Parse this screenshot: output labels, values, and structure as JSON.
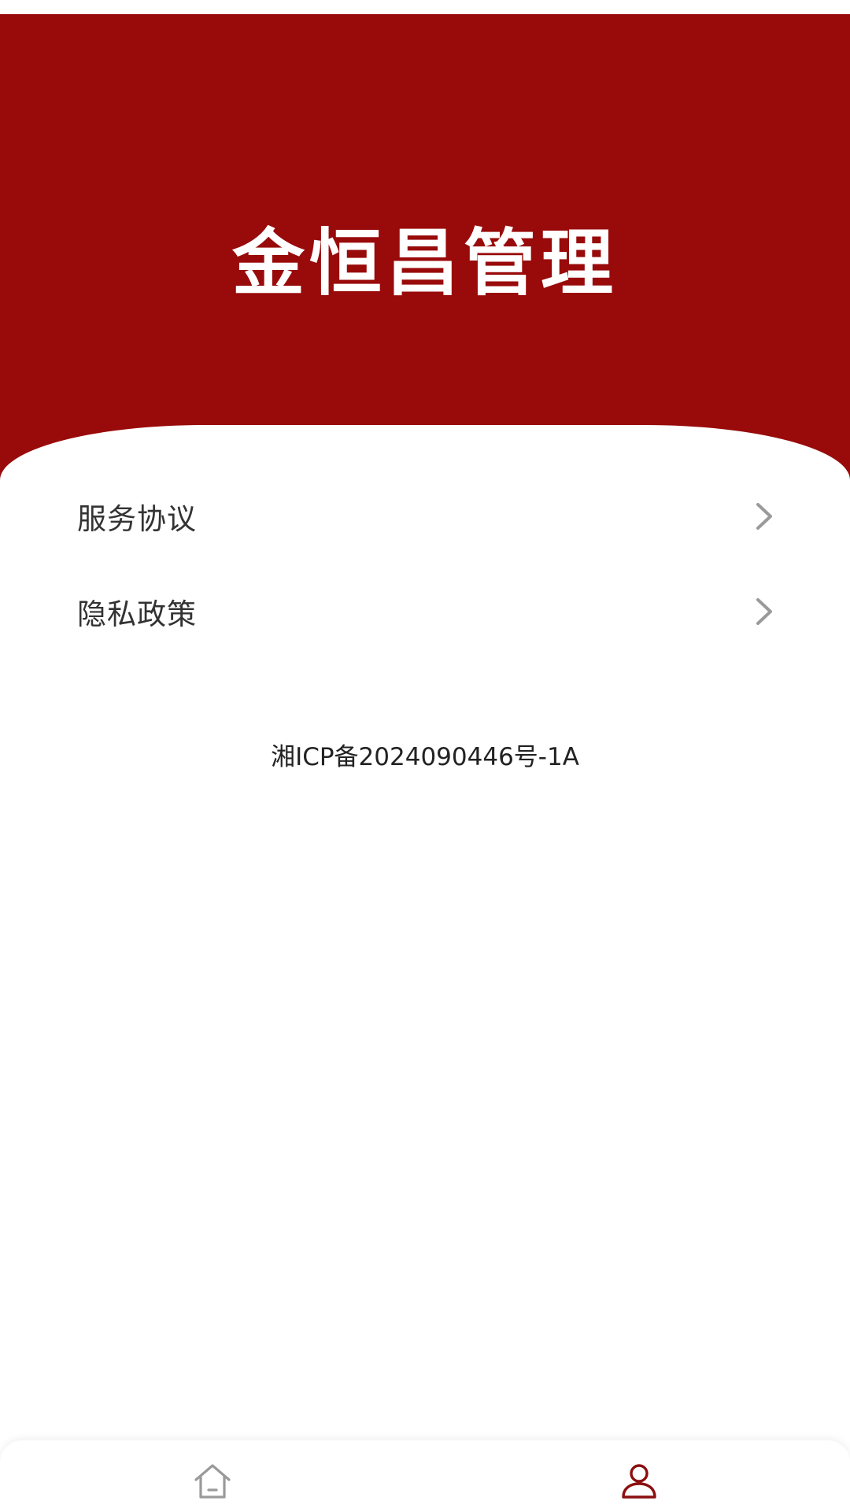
{
  "header": {
    "title": "金恒昌管理"
  },
  "menu": {
    "items": [
      {
        "label": "服务协议",
        "icon": "chevron-right-icon"
      },
      {
        "label": "隐私政策",
        "icon": "chevron-right-icon"
      }
    ]
  },
  "footer": {
    "icp": "湘ICP备2024090446号-1A"
  },
  "tabbar": {
    "tabs": [
      {
        "icon": "home-icon",
        "active": false
      },
      {
        "icon": "user-icon",
        "active": true
      }
    ]
  },
  "colors": {
    "brand": "#990a0a",
    "chevron": "#9a9a9a",
    "tab_inactive": "#9a9a9a",
    "tab_active": "#8b0f0f"
  }
}
